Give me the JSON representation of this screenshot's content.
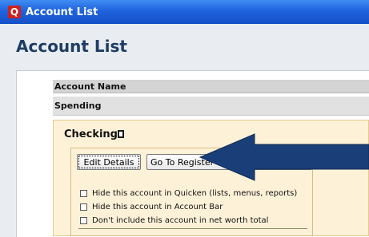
{
  "window": {
    "title": "Account List",
    "app_icon_letter": "Q"
  },
  "page": {
    "title": "Account List"
  },
  "table": {
    "column_header": "Account Name",
    "group_label": "Spending"
  },
  "account": {
    "name": "Checking",
    "buttons": {
      "edit_details": "Edit Details",
      "go_to_register": "Go To Register"
    },
    "options": [
      "Hide this account in Quicken (lists, menus, reports)",
      "Hide this account in Account Bar",
      "Don't include this account in net worth total"
    ]
  },
  "annotation": {
    "arrow_color": "#1a3f78"
  }
}
